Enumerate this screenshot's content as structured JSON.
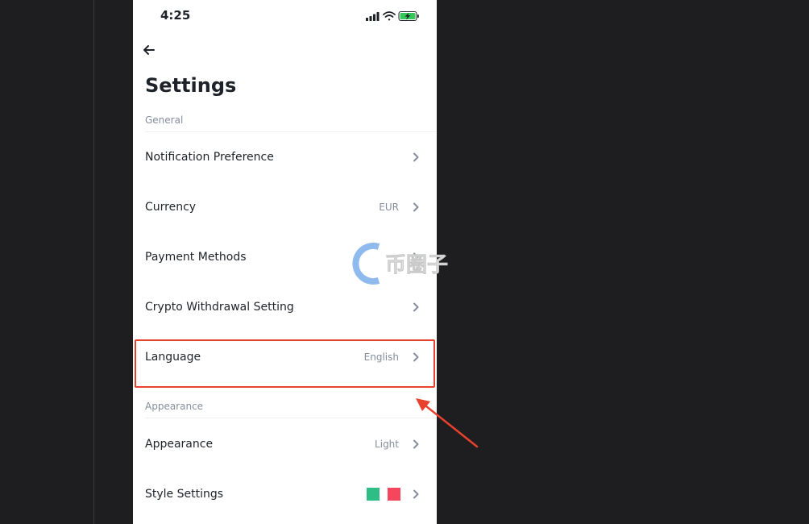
{
  "status_bar": {
    "time": "4:25"
  },
  "page": {
    "title": "Settings"
  },
  "sections": {
    "general": "General",
    "appearance": "Appearance"
  },
  "rows": {
    "notification": {
      "label": "Notification Preference"
    },
    "currency": {
      "label": "Currency",
      "value": "EUR"
    },
    "payment": {
      "label": "Payment Methods"
    },
    "withdrawal": {
      "label": "Crypto Withdrawal Setting"
    },
    "language": {
      "label": "Language",
      "value": "English"
    },
    "appearance": {
      "label": "Appearance",
      "value": "Light"
    },
    "style": {
      "label": "Style Settings"
    }
  },
  "colors": {
    "style_up": "#2ebd85",
    "style_down": "#f6465d",
    "highlight": "#e8412e"
  },
  "watermark": {
    "text": "币圈子"
  },
  "icons": [
    "back-arrow-icon",
    "chevron-right-icon",
    "signal-icon",
    "wifi-icon",
    "battery-charging-icon"
  ]
}
